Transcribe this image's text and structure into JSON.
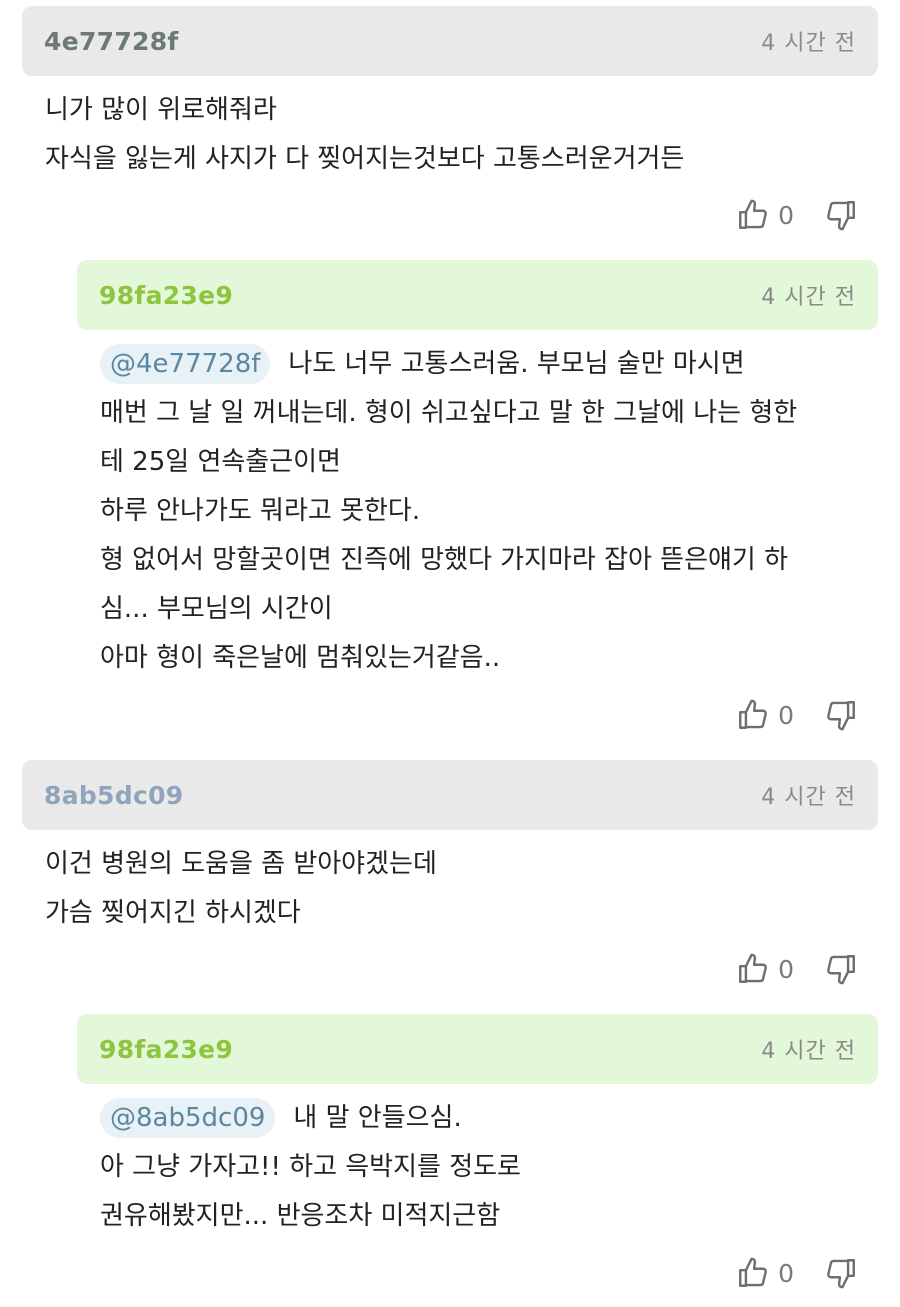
{
  "comments": [
    {
      "id": "4e77728f",
      "time": "4 시간 전",
      "lines": [
        "니가 많이 위로해줘라",
        "자식을 잃는게 사지가 다 찢어지는것보다 고통스러운거거든"
      ],
      "like_count": "0"
    },
    {
      "id": "98fa23e9",
      "time": "4 시간 전",
      "mention": "@4e77728f",
      "first_line": "나도 너무 고통스러움. 부모님 술만 마시면",
      "lines": [
        "매번 그 날 일 꺼내는데. 형이 쉬고싶다고 말 한 그날에 나는 형한",
        "테 25일 연속출근이면",
        "하루 안나가도 뭐라고 못한다.",
        "형 없어서 망할곳이면 진즉에 망했다 가지마라 잡아 뜯은얘기 하",
        "심... 부모님의 시간이",
        "아마 형이 죽은날에 멈춰있는거같음.."
      ],
      "like_count": "0"
    },
    {
      "id": "8ab5dc09",
      "time": "4 시간 전",
      "lines": [
        "이건 병원의 도움을 좀 받아야겠는데",
        "가슴 찢어지긴 하시겠다"
      ],
      "like_count": "0"
    },
    {
      "id": "98fa23e9",
      "time": "4 시간 전",
      "mention": "@8ab5dc09",
      "first_line": "내 말 안들으심.",
      "lines": [
        "아 그냥 가자고!! 하고 윽박지를 정도로",
        "권유해봤지만... 반응조차 미적지근함"
      ],
      "like_count": "0"
    }
  ],
  "colors": {
    "uid_gray": "#6b7a72",
    "uid_green": "#8cc63f",
    "uid_blue": "#8fa4bd",
    "header_gray": "#e9e9e9",
    "header_green": "#e3f7d9",
    "mention_bg": "#e7f1f6"
  },
  "icons": {
    "like": "thumbs-up-icon",
    "dislike": "thumbs-down-icon"
  }
}
